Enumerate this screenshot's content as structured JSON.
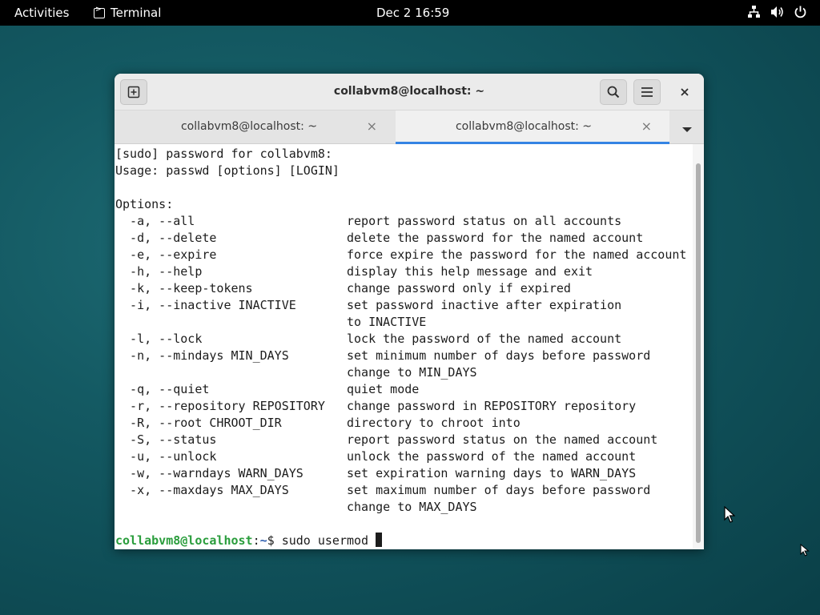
{
  "topbar": {
    "activities": "Activities",
    "app_name": "Terminal",
    "clock": "Dec 2  16:59"
  },
  "window": {
    "title": "collabvm8@localhost: ~",
    "tabs": [
      {
        "label": "collabvm8@localhost: ~",
        "active": false
      },
      {
        "label": "collabvm8@localhost: ~",
        "active": true
      }
    ]
  },
  "terminal": {
    "lines": [
      "[sudo] password for collabvm8:",
      "Usage: passwd [options] [LOGIN]",
      "",
      "Options:",
      "  -a, --all                     report password status on all accounts",
      "  -d, --delete                  delete the password for the named account",
      "  -e, --expire                  force expire the password for the named account",
      "  -h, --help                    display this help message and exit",
      "  -k, --keep-tokens             change password only if expired",
      "  -i, --inactive INACTIVE       set password inactive after expiration",
      "                                to INACTIVE",
      "  -l, --lock                    lock the password of the named account",
      "  -n, --mindays MIN_DAYS        set minimum number of days before password",
      "                                change to MIN_DAYS",
      "  -q, --quiet                   quiet mode",
      "  -r, --repository REPOSITORY   change password in REPOSITORY repository",
      "  -R, --root CHROOT_DIR         directory to chroot into",
      "  -S, --status                  report password status on the named account",
      "  -u, --unlock                  unlock the password of the named account",
      "  -w, --warndays WARN_DAYS      set expiration warning days to WARN_DAYS",
      "  -x, --maxdays MAX_DAYS        set maximum number of days before password",
      "                                change to MAX_DAYS",
      ""
    ],
    "prompt_user": "collabvm8@localhost",
    "prompt_sep": ":",
    "prompt_path": "~",
    "prompt_symbol": "$ ",
    "command": "sudo usermod "
  },
  "colors": {
    "accent": "#3584e4",
    "prompt_user": "#2a9d3c",
    "prompt_path": "#2f5fb0"
  },
  "icons": [
    "terminal-icon",
    "network-icon",
    "volume-icon",
    "power-icon",
    "new-tab-icon",
    "search-icon",
    "hamburger-menu-icon",
    "close-icon",
    "chevron-down-icon",
    "mouse-pointer-icon"
  ]
}
